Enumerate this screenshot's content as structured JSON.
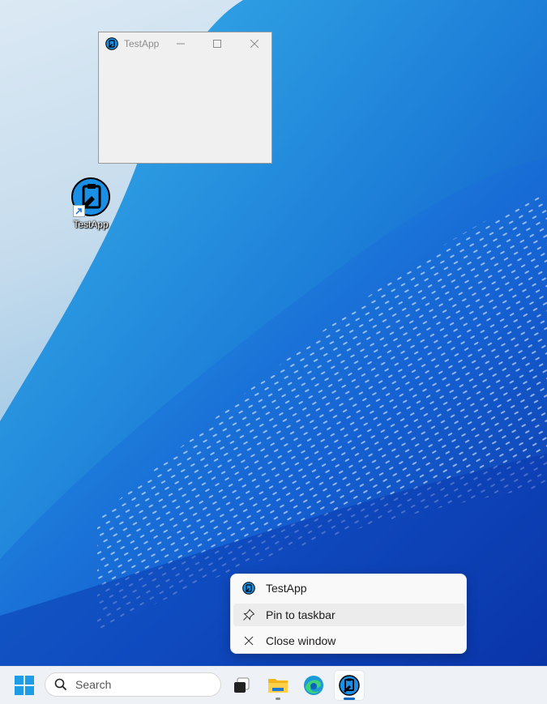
{
  "window": {
    "title": "TestApp",
    "controls": [
      "minimize",
      "maximize",
      "close"
    ]
  },
  "desktop": {
    "shortcut_label": "TestApp"
  },
  "context_menu": {
    "items": [
      {
        "label": "TestApp",
        "icon": "testapp-icon"
      },
      {
        "label": "Pin to taskbar",
        "icon": "pin-icon"
      },
      {
        "label": "Close window",
        "icon": "close-icon"
      }
    ],
    "hovered_index": 1
  },
  "taskbar": {
    "search_placeholder": "Search",
    "apps": [
      "task-view-icon",
      "file-explorer-icon",
      "edge-icon",
      "testapp-icon"
    ]
  },
  "colors": {
    "accent": "#0067c0",
    "app_icon_blue": "#1a8fe6"
  }
}
